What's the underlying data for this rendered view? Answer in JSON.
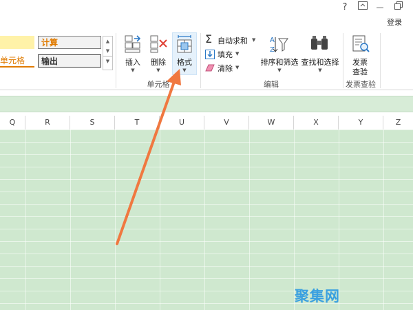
{
  "titlebar": {
    "help": "?",
    "restore_icon": "ribbon-display-options-icon",
    "minimize": "—",
    "maximize_icon": "restore-window-icon"
  },
  "account": {
    "login_label": "登录"
  },
  "styles": {
    "calc_label": "计算",
    "output_label": "输出",
    "cell_partial_label": "单元格"
  },
  "cells_group": {
    "insert_label": "插入",
    "delete_label": "删除",
    "format_label": "格式",
    "group_label": "单元格"
  },
  "edit_group": {
    "autosum_label": "自动求和",
    "fill_label": "填充",
    "clear_label": "清除",
    "sort_filter_label": "排序和筛选",
    "find_select_label": "查找和选择",
    "group_label": "编辑"
  },
  "invoice_group": {
    "check_line1": "发票",
    "check_line2": "查验",
    "group_label": "发票查验"
  },
  "columns": [
    "Q",
    "R",
    "S",
    "T",
    "U",
    "V",
    "W",
    "X",
    "Y",
    "Z"
  ],
  "watermark": "聚集网",
  "colors": {
    "sheet_bg": "#cfe8cf",
    "formula_bg": "#d7ecd7",
    "arrow": "#f07840",
    "calc_bg": "#f2f2f2",
    "style_yellow": "#fff2a8",
    "style_orange_text": "#e07b00"
  }
}
